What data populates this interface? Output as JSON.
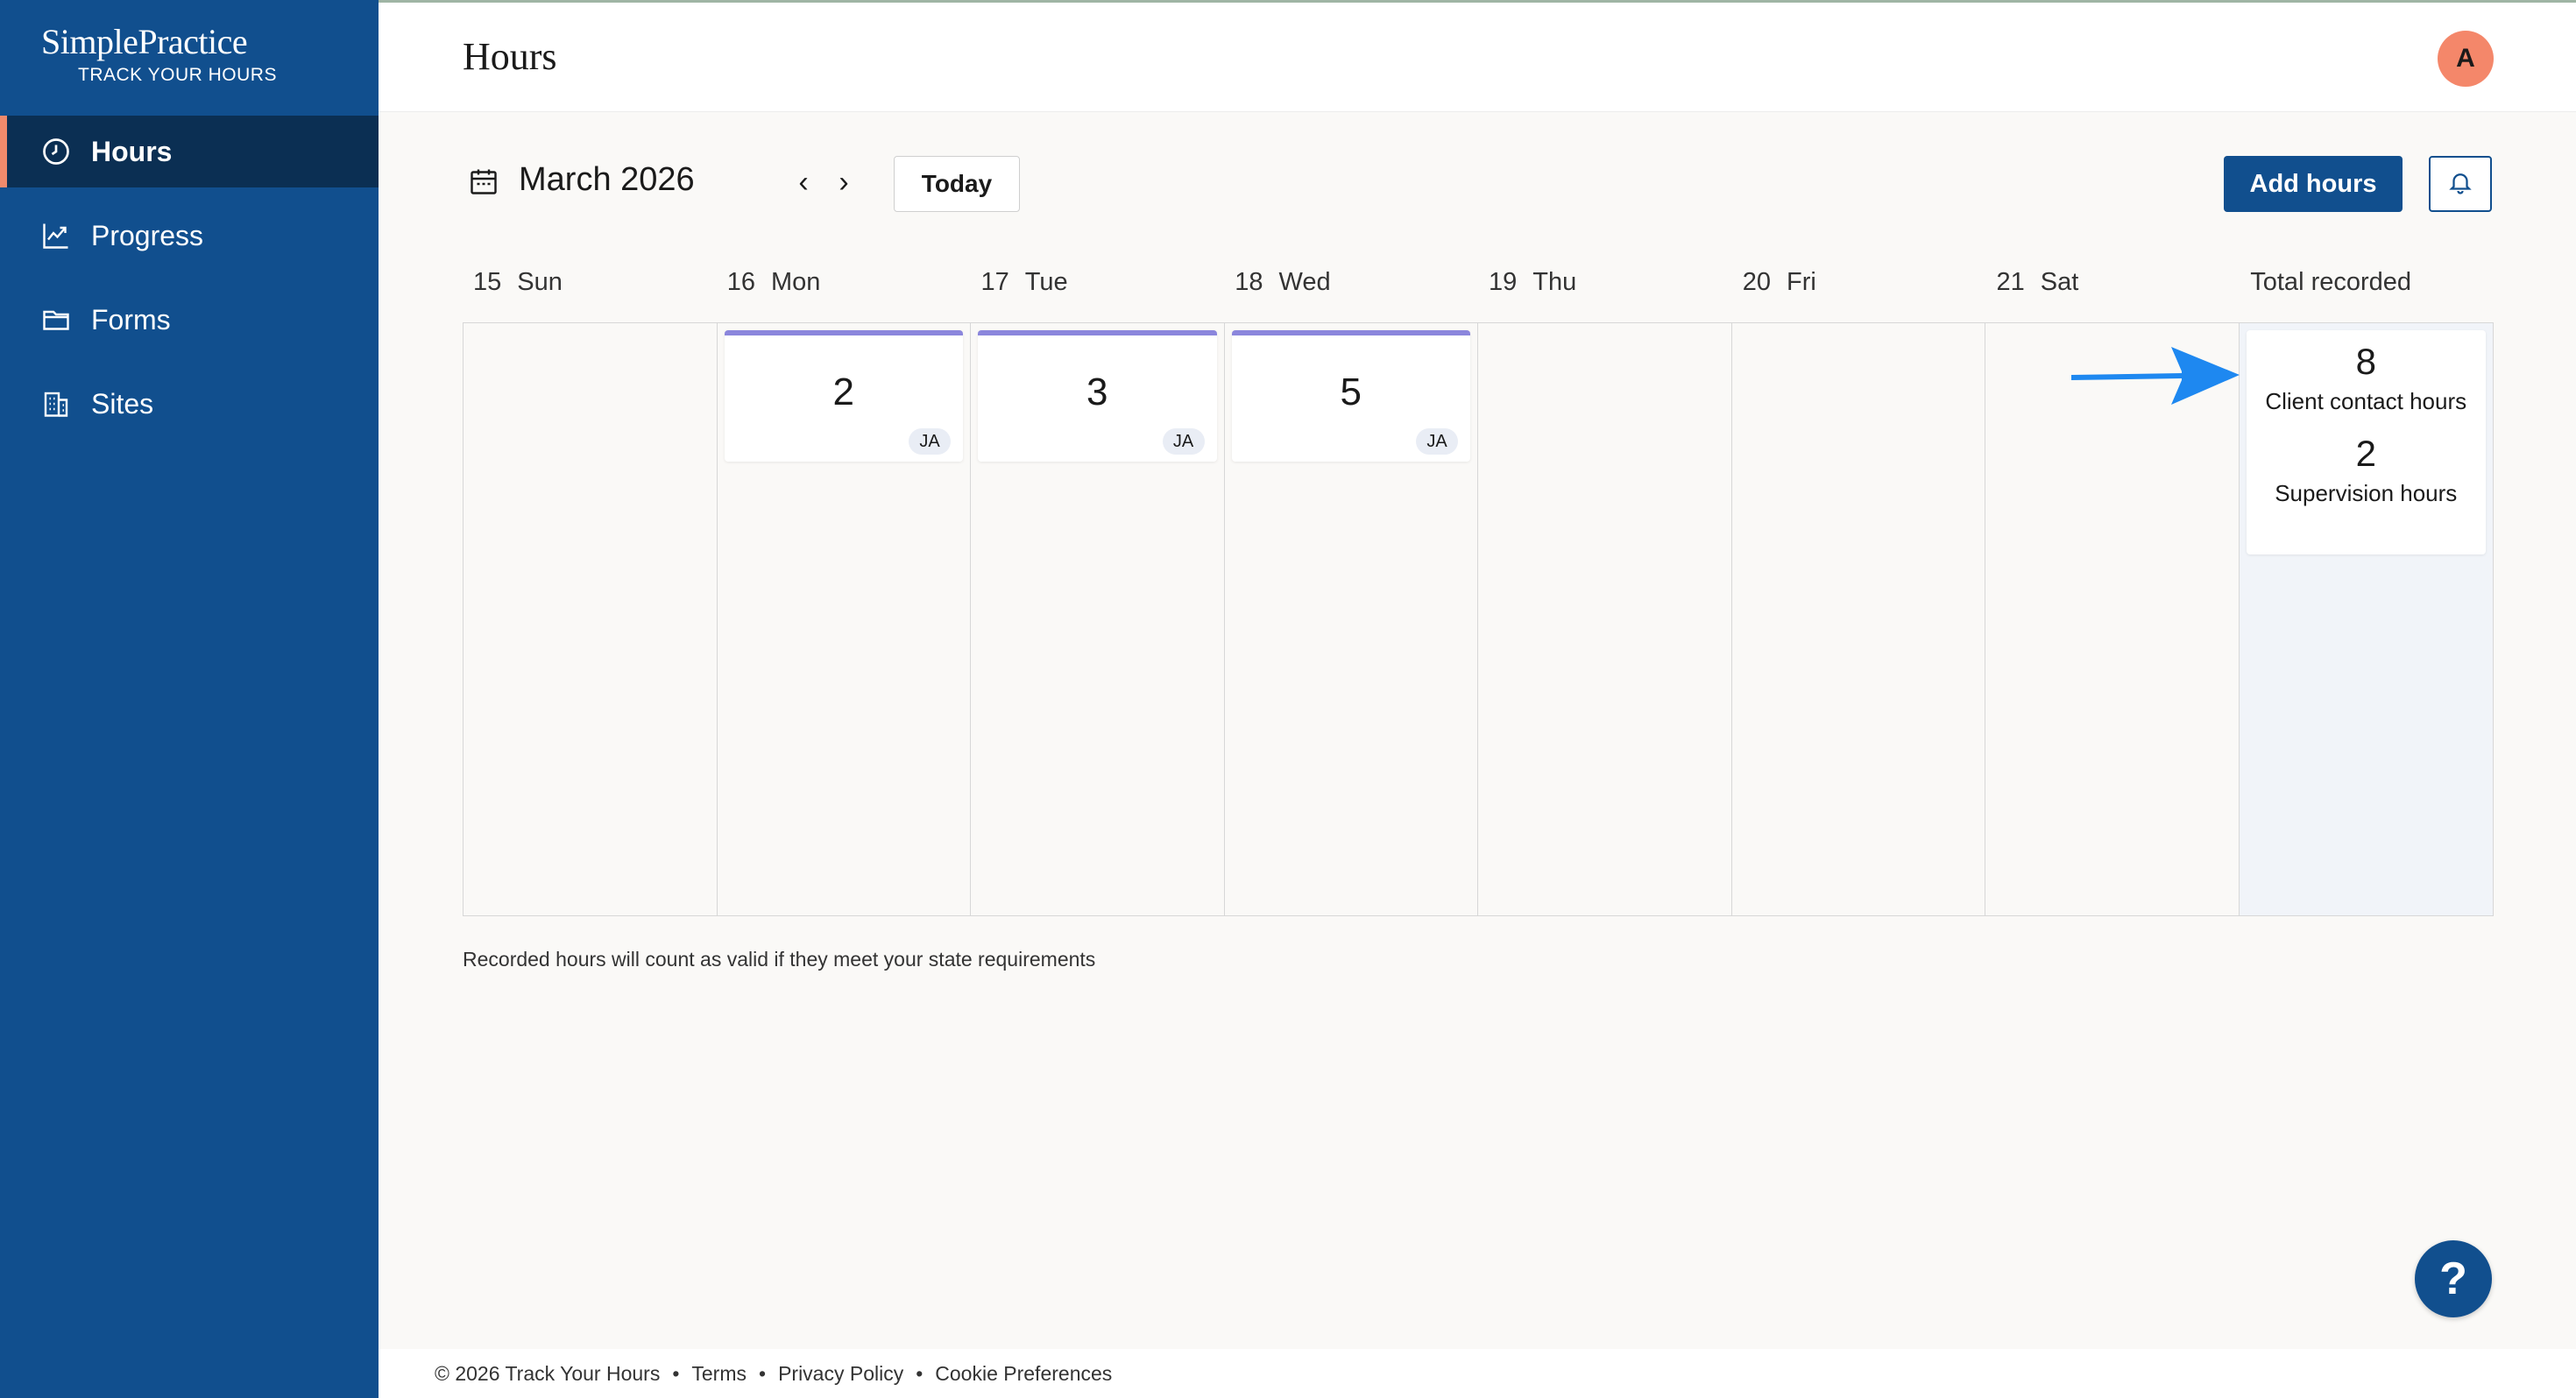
{
  "sidebar": {
    "logo_main": "SimplePractice",
    "logo_sub": "TRACK YOUR HOURS",
    "items": [
      {
        "label": "Hours",
        "icon": "clock-icon",
        "active": true
      },
      {
        "label": "Progress",
        "icon": "chart-icon",
        "active": false
      },
      {
        "label": "Forms",
        "icon": "folder-icon",
        "active": false
      },
      {
        "label": "Sites",
        "icon": "building-icon",
        "active": false
      }
    ]
  },
  "header": {
    "title": "Hours",
    "avatar_initial": "A"
  },
  "toolbar": {
    "month": "March 2026",
    "prev_label": "‹",
    "next_label": "›",
    "today_label": "Today",
    "add_label": "Add hours"
  },
  "week": {
    "days": [
      {
        "num": "15",
        "name": "Sun"
      },
      {
        "num": "16",
        "name": "Mon"
      },
      {
        "num": "17",
        "name": "Tue"
      },
      {
        "num": "18",
        "name": "Wed"
      },
      {
        "num": "19",
        "name": "Thu"
      },
      {
        "num": "20",
        "name": "Fri"
      },
      {
        "num": "21",
        "name": "Sat"
      }
    ],
    "total_header": "Total recorded",
    "entries": [
      {
        "day": "16",
        "hours": "2",
        "initials": "JA"
      },
      {
        "day": "17",
        "hours": "3",
        "initials": "JA"
      },
      {
        "day": "18",
        "hours": "5",
        "initials": "JA"
      }
    ],
    "totals": {
      "client_contact_value": "8",
      "client_contact_label": "Client contact hours",
      "supervision_value": "2",
      "supervision_label": "Supervision hours"
    }
  },
  "footnote": "Recorded hours will count as valid if they meet your state requirements",
  "help_label": "?",
  "footer": {
    "copyright": "© 2026 Track Your Hours",
    "sep": "•",
    "terms": "Terms",
    "privacy": "Privacy Policy",
    "cookies": "Cookie Preferences"
  },
  "colors": {
    "sidebar_bg": "#114f8e",
    "active_nav_bg": "#0b2f53",
    "active_accent": "#f08a6c",
    "entry_accent": "#8b86dc",
    "annotation_arrow": "#1e88f0"
  }
}
